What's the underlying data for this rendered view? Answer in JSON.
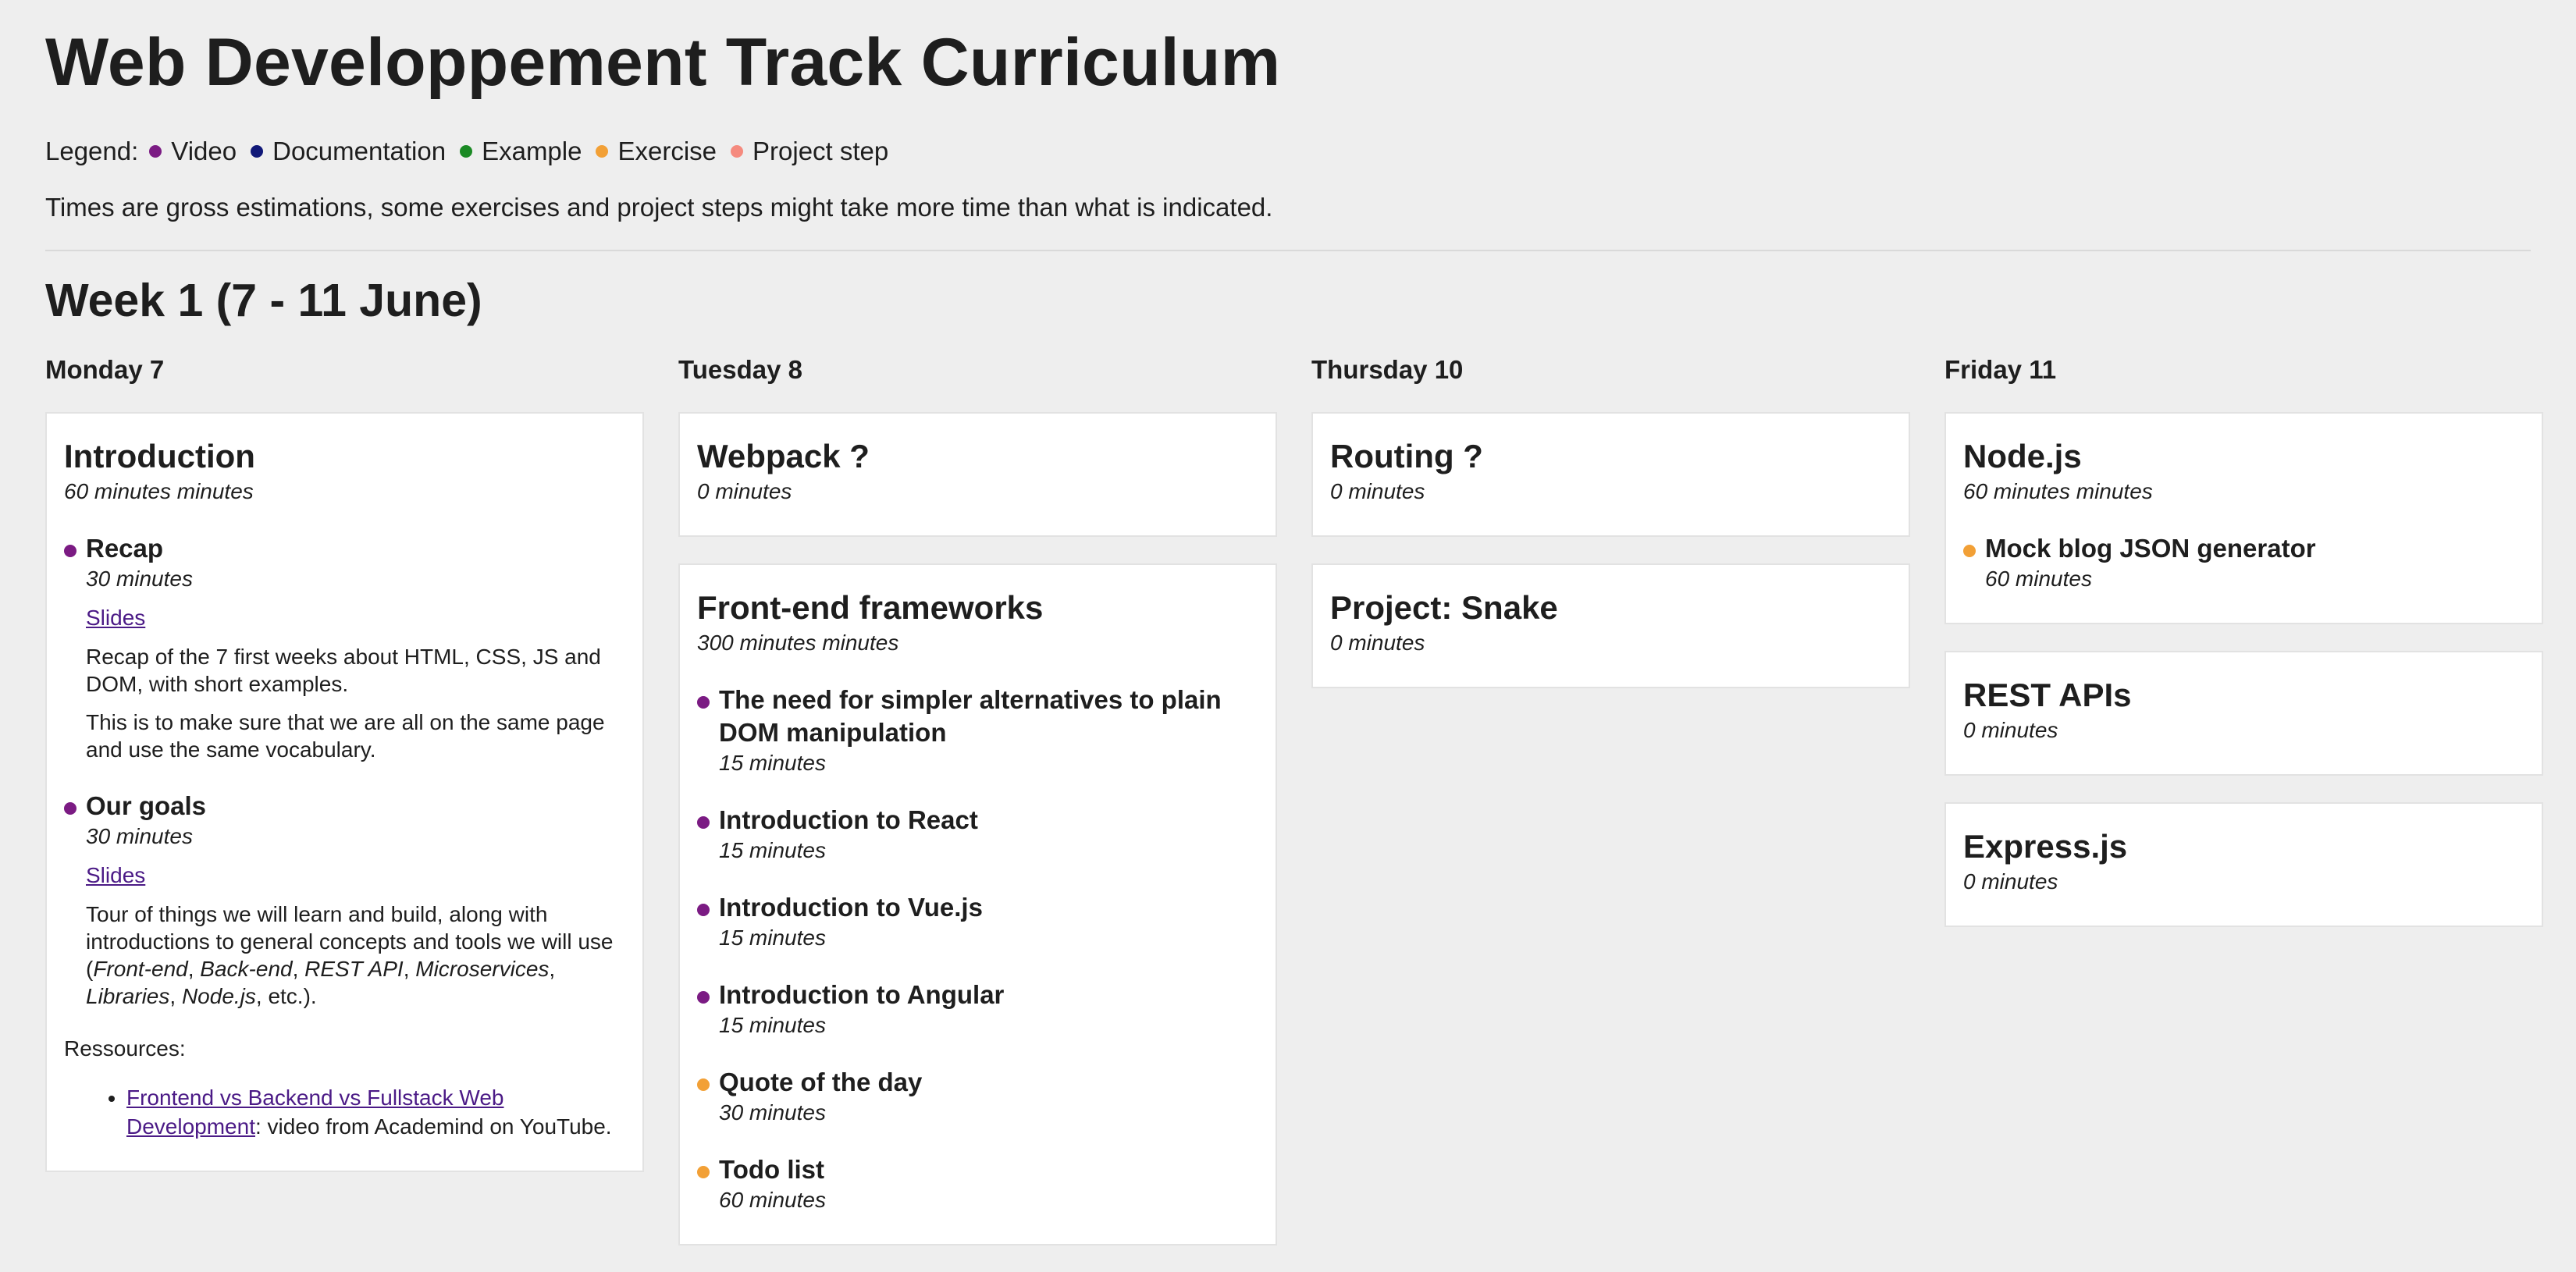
{
  "page": {
    "title": "Web Developpement Track Curriculum",
    "legend": {
      "label": "Legend:",
      "items": [
        {
          "label": "Video",
          "color": "#7b1b83"
        },
        {
          "label": "Documentation",
          "color": "#101878"
        },
        {
          "label": "Example",
          "color": "#1b8a24"
        },
        {
          "label": "Exercise",
          "color": "#f2a036"
        },
        {
          "label": "Project step",
          "color": "#f58a7e"
        }
      ]
    },
    "note": "Times are gross estimations, some exercises and project steps might take more time than what is indicated."
  },
  "week": {
    "title": "Week 1 (7 - 11 June)",
    "days": [
      {
        "title": "Monday 7",
        "cards": [
          {
            "title": "Introduction",
            "duration": "60 minutes minutes",
            "items": [
              {
                "kind": "video",
                "title": "Recap",
                "duration": "30 minutes",
                "link": "Slides",
                "paragraphs": [
                  "Recap of the 7 first weeks about HTML, CSS, JS and DOM, with short examples.",
                  "This is to make sure that we are all on the same page and use the same vocabulary."
                ]
              },
              {
                "kind": "video",
                "title": "Our goals",
                "duration": "30 minutes",
                "link": "Slides",
                "paragraph_parts": [
                  "Tour of things we will learn and build, along with introductions to general concepts and tools we will use (",
                  "Front-end",
                  ", ",
                  "Back-end",
                  ", ",
                  "REST API",
                  ", ",
                  "Microservices",
                  ", ",
                  "Libraries",
                  ", ",
                  "Node.js",
                  ", etc.)."
                ]
              }
            ],
            "resources_label": "Ressources:",
            "resources": [
              {
                "link": "Frontend vs Backend vs Fullstack Web Development",
                "text": ": video from Academind on YouTube."
              }
            ]
          }
        ]
      },
      {
        "title": "Tuesday 8",
        "cards": [
          {
            "title": "Webpack ?",
            "duration": "0 minutes",
            "items": []
          },
          {
            "title": "Front-end frameworks",
            "duration": "300 minutes minutes",
            "items": [
              {
                "kind": "video",
                "title": "The need for simpler alternatives to plain DOM manipulation",
                "duration": "15 minutes"
              },
              {
                "kind": "video",
                "title": "Introduction to React",
                "duration": "15 minutes"
              },
              {
                "kind": "video",
                "title": "Introduction to Vue.js",
                "duration": "15 minutes"
              },
              {
                "kind": "video",
                "title": "Introduction to Angular",
                "duration": "15 minutes"
              },
              {
                "kind": "exercise",
                "title": "Quote of the day",
                "duration": "30 minutes"
              },
              {
                "kind": "exercise",
                "title": "Todo list",
                "duration": "60 minutes"
              }
            ]
          }
        ]
      },
      {
        "title": "Thursday 10",
        "cards": [
          {
            "title": "Routing ?",
            "duration": "0 minutes",
            "items": []
          },
          {
            "title": "Project: Snake",
            "duration": "0 minutes",
            "items": []
          }
        ]
      },
      {
        "title": "Friday 11",
        "cards": [
          {
            "title": "Node.js",
            "duration": "60 minutes minutes",
            "items": [
              {
                "kind": "exercise",
                "title": "Mock blog JSON generator",
                "duration": "60 minutes"
              }
            ]
          },
          {
            "title": "REST APIs",
            "duration": "0 minutes",
            "items": []
          },
          {
            "title": "Express.js",
            "duration": "0 minutes",
            "items": []
          }
        ]
      }
    ]
  }
}
